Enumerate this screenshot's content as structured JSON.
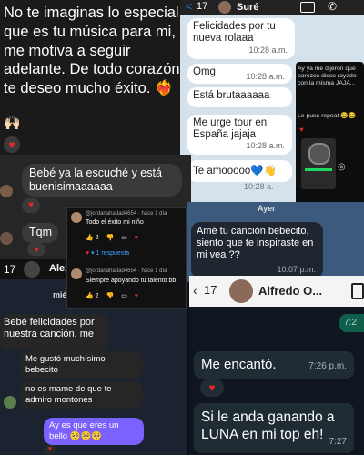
{
  "story": {
    "text": "No te imaginas lo especial que es tu música para mi, me motiva a seguir adelante. De todo corazón te deseo mucho éxito.",
    "emoji": "❤️‍🔥",
    "hands": "🙌🏻",
    "heart": "♥"
  },
  "sure_chat": {
    "title": "Suré",
    "back": "<",
    "messages": [
      {
        "text": "Felicidades por tu nueva rolaaa",
        "time": "10:28 a.m."
      },
      {
        "text": "Omg",
        "time": "10:28 a.m."
      },
      {
        "text": "Está brutaaaaaa",
        "time": ""
      },
      {
        "text": "Me urge tour en España jajaja",
        "time": "10:28 a.m."
      },
      {
        "text": "Te amooooo💙👋",
        "time": ""
      }
    ],
    "time_pair": "10:28 a."
  },
  "inset": {
    "msg1": "Ay ya me dijeron que parezco disco rayado con la misma JAJA...",
    "msg2": "Le puse repeat 😂😂"
  },
  "comments": {
    "reply1": "Bebé ya la escuché y está buenisimaaaaaa",
    "reply2": "Tqm",
    "handle": "Alex",
    "count": "17"
  },
  "ig_card": {
    "c1_user": "@jordanahadad4654 · hace 1 día",
    "c1_text": "Todo el éxito mi niño",
    "c1_likes": "2",
    "replies": "1 respuesta",
    "c2_user": "@jordanahadad4654 · hace 1 día",
    "c2_text": "Siempre apoyando tu talento bb",
    "c2_likes": "2"
  },
  "dm": {
    "label": "mié",
    "msg1": "Bebé felicidades por nuestra canción, me",
    "msg2": "Me gustó muchísimo bebecito",
    "msg3": "no es mame de que te admiro montones",
    "msg4": "Ay es que eres un bello 🥺🥺🥺"
  },
  "ayer_chat": {
    "label": "Ayer",
    "msg": "Amé tu canción bebecito, siento que te inspiraste en mi vea ??",
    "time": "10:07 p.m."
  },
  "alfredo_chat": {
    "count": "17",
    "name": "Alfredo O...",
    "time_top": "7:2",
    "msg1": "Me encantó.",
    "time1": "7:26 p.m.",
    "msg2": "Si le anda ganando a LUNA en mi top eh!",
    "time2": "7:27"
  },
  "colors": {
    "heart": "#e02a2a",
    "ig_link": "#3ea6ff",
    "dm_bubble_right": "#7b61ff",
    "wa_time": "#a8b3bf"
  }
}
